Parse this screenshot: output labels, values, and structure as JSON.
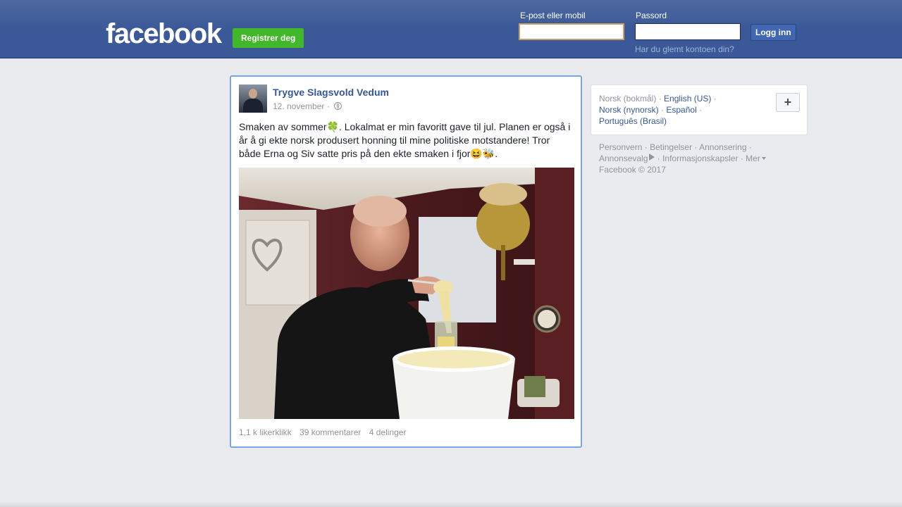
{
  "header": {
    "logo": "facebook",
    "register_label": "Registrer deg",
    "email_label": "E-post eller mobil",
    "email_value": "",
    "password_label": "Passord",
    "password_value": "",
    "login_label": "Logg inn",
    "forgot_label": "Har du glemt kontoen din?"
  },
  "post": {
    "author": "Trygve Slagsvold Vedum",
    "date": "12. november",
    "date_sep": "·",
    "text_part1": "Smaken av sommer",
    "emoji1": "🍀",
    "text_part2": ". Lokalmat er min favoritt gave til jul. Planen er også i år å gi ekte norsk produsert honning til mine politiske motstandere! Tror både Erna og Siv satte pris på den ekte smaken i fjor",
    "emoji2": "😆",
    "emoji3": "🐝",
    "text_end": ".",
    "likes": "1,1 k likerklikk",
    "comments": "39 kommentarer",
    "shares": "4 delinger"
  },
  "languages": {
    "current": "Norsk (bokmål)",
    "items": [
      "English (US)",
      "Norsk (nynorsk)",
      "Español",
      "Português (Brasil)"
    ],
    "sep": "·",
    "add_label": "+"
  },
  "footer": {
    "links": [
      "Personvern",
      "Betingelser",
      "Annonsering",
      "Annonsevalg",
      "Informasjonskapsler",
      "Mer"
    ],
    "copyright": "Facebook © 2017"
  },
  "colors": {
    "brand_blue": "#3b5998",
    "link_blue": "#365899",
    "register_green": "#42b72a"
  }
}
